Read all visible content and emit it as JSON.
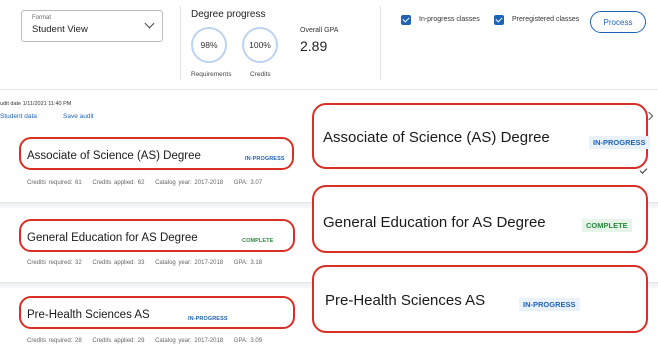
{
  "format": {
    "label": "Format",
    "value": "Student View"
  },
  "degree_progress": {
    "title": "Degree progress",
    "requirements": {
      "value": "98%",
      "label": "Requirements"
    },
    "credits": {
      "value": "100%",
      "label": "Credits"
    },
    "overall_gpa": {
      "label": "Overall GPA",
      "value": "2.89"
    }
  },
  "options": {
    "in_progress": "In-progress classes",
    "preregistered": "Preregistered classes",
    "process": "Process"
  },
  "audit": {
    "date": "udit date 1/11/2021 11:40 PM",
    "student_data": "Student data",
    "save_audit": "Save audit"
  },
  "degrees": [
    {
      "title": "Associate of Science (AS) Degree",
      "status": "IN-PROGRESS",
      "credits_required": "Credits required:  61",
      "credits_applied": "Credits applied:  62",
      "catalog_year": "Catalog year:  2017-2018",
      "gpa": "GPA:  3.07"
    },
    {
      "title": "General Education for AS Degree",
      "status": "COMPLETE",
      "credits_required": "Credits required:  32",
      "credits_applied": "Credits applied:  33",
      "catalog_year": "Catalog year:  2017-2018",
      "gpa": "GPA:  3.18"
    },
    {
      "title": "Pre-Health Sciences AS",
      "status": "IN-PROGRESS",
      "credits_required": "Credits required:  28",
      "credits_applied": "Credits applied:  29",
      "catalog_year": "Catalog year:  2017-2018",
      "gpa": "GPA:  3.09"
    }
  ],
  "colors": {
    "accent": "#1f63b8",
    "highlight": "#d93025",
    "complete": "#2a8a3e"
  }
}
